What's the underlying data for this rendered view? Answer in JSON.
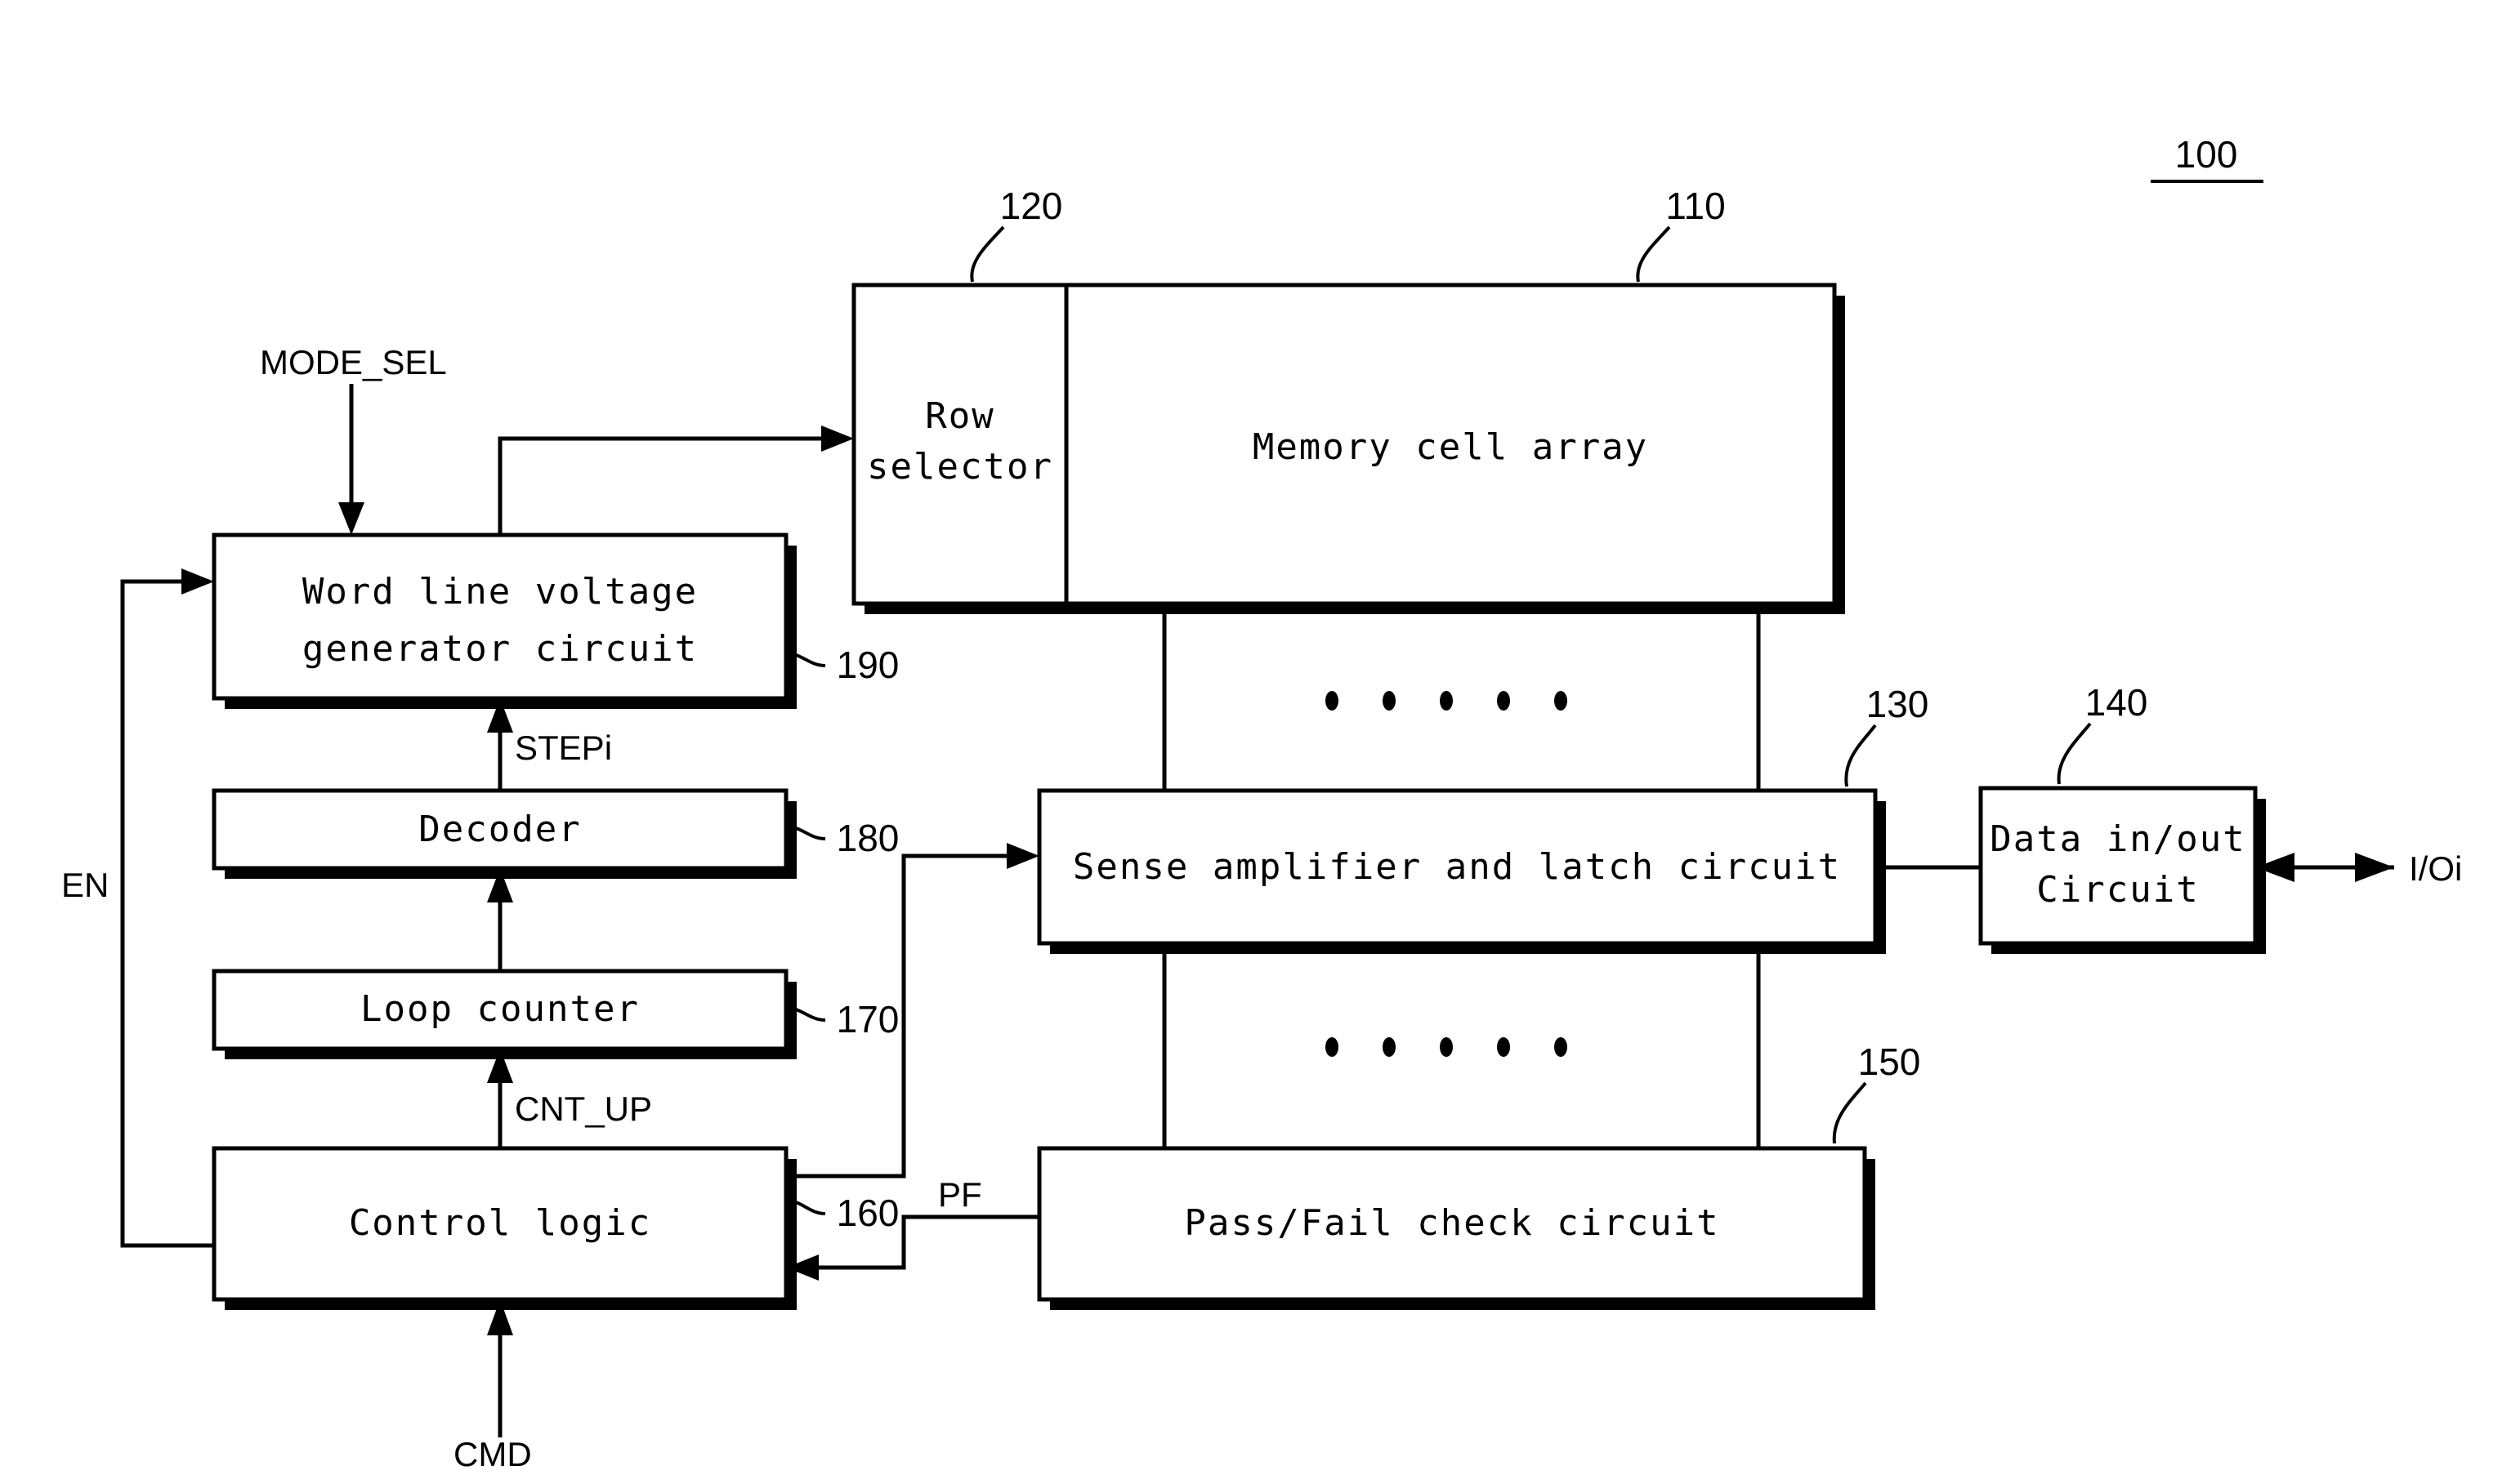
{
  "figure": {
    "device_ref": "100",
    "blocks": [
      {
        "id": "memory_cell_array",
        "label": "Memory cell array",
        "ref": "110"
      },
      {
        "id": "row_selector",
        "label_line1": "Row",
        "label_line2": "selector",
        "ref": "120"
      },
      {
        "id": "sense_amplifier",
        "label": "Sense amplifier and latch circuit",
        "ref": "130"
      },
      {
        "id": "data_in_out",
        "label_line1": "Data in/out",
        "label_line2": "Circuit",
        "ref": "140"
      },
      {
        "id": "pass_fail",
        "label": "Pass/Fail check circuit",
        "ref": "150"
      },
      {
        "id": "control_logic",
        "label": "Control logic",
        "ref": "160"
      },
      {
        "id": "loop_counter",
        "label": "Loop counter",
        "ref": "170"
      },
      {
        "id": "decoder",
        "label": "Decoder",
        "ref": "180"
      },
      {
        "id": "wl_voltage_gen",
        "label_line1": "Word line voltage",
        "label_line2": "generator circuit",
        "ref": "190"
      }
    ],
    "signals": [
      {
        "id": "mode_sel",
        "label": "MODE_SEL"
      },
      {
        "id": "stepi",
        "label": "STEPi"
      },
      {
        "id": "cnt_up",
        "label": "CNT_UP"
      },
      {
        "id": "cmd",
        "label": "CMD"
      },
      {
        "id": "en",
        "label": "EN"
      },
      {
        "id": "pf",
        "label": "PF"
      },
      {
        "id": "ioi",
        "label": "I/Oi"
      }
    ],
    "ellipsis_dots": 5,
    "colors": {
      "ink": "#000000",
      "paper": "#ffffff"
    }
  }
}
